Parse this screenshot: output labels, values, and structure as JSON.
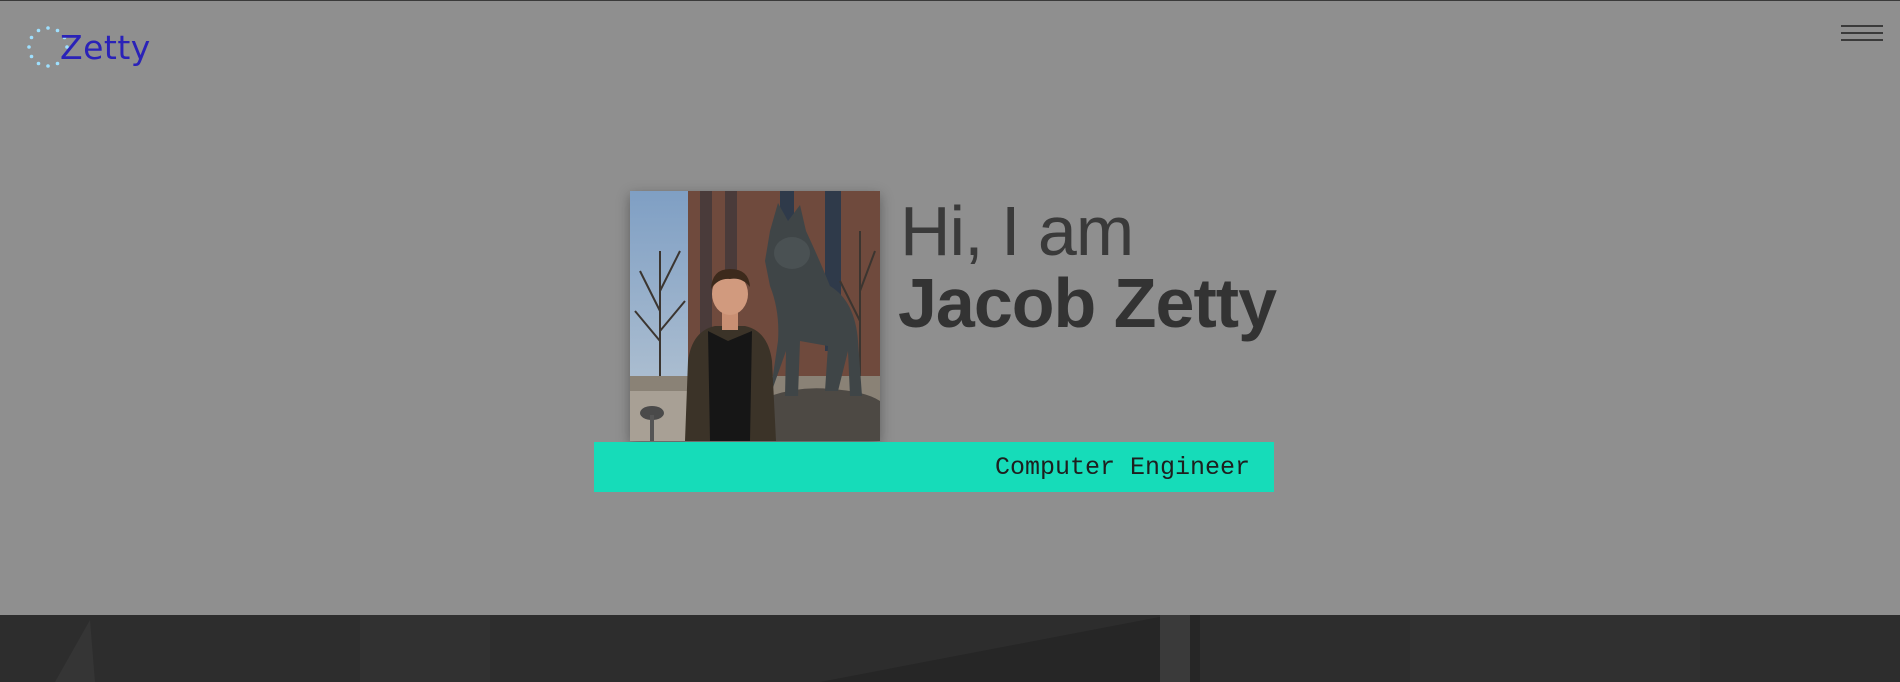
{
  "header": {
    "logo_text": "Zetty",
    "logo_icon": "dotted-circle-icon",
    "menu_icon": "hamburger-icon"
  },
  "hero": {
    "greeting": "Hi, I am",
    "name": "Jacob Zetty",
    "role": "Computer Engineer",
    "photo": "profile-photo-with-husky-statue"
  },
  "colors": {
    "hero_bg": "#8f8f8f",
    "accent": "#16dcb9",
    "logo": "#2a22b8",
    "logo_dots": "#9ee0ff",
    "dark": "#2d2d2d"
  }
}
